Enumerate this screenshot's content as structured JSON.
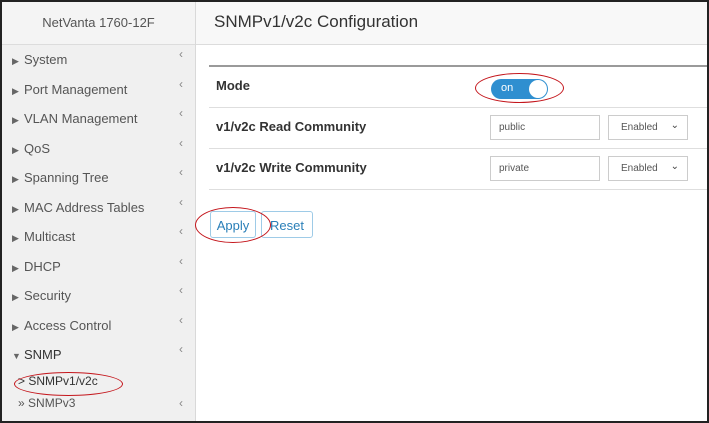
{
  "sidebar": {
    "brand": "NetVanta 1760-12F",
    "items": [
      {
        "label": "System"
      },
      {
        "label": "Port Management"
      },
      {
        "label": "VLAN Management"
      },
      {
        "label": "QoS"
      },
      {
        "label": "Spanning Tree"
      },
      {
        "label": "MAC Address Tables"
      },
      {
        "label": "Multicast"
      },
      {
        "label": "DHCP"
      },
      {
        "label": "Security"
      },
      {
        "label": "Access Control"
      },
      {
        "label": "SNMP"
      }
    ],
    "sub_items": [
      {
        "label": "SNMPv1/v2c",
        "prefix": ">"
      },
      {
        "label": "SNMPv3",
        "prefix": "»"
      }
    ]
  },
  "main": {
    "title": "SNMPv1/v2c Configuration",
    "mode": {
      "label": "Mode",
      "toggle_text": "on",
      "state": "on"
    },
    "read_community": {
      "label": "v1/v2c Read Community",
      "value": "public",
      "status": "Enabled"
    },
    "write_community": {
      "label": "v1/v2c Write Community",
      "value": "private",
      "status": "Enabled"
    },
    "buttons": {
      "apply": "Apply",
      "reset": "Reset"
    }
  },
  "colors": {
    "accent": "#2f8fd0",
    "annotation": "#c4161c"
  }
}
